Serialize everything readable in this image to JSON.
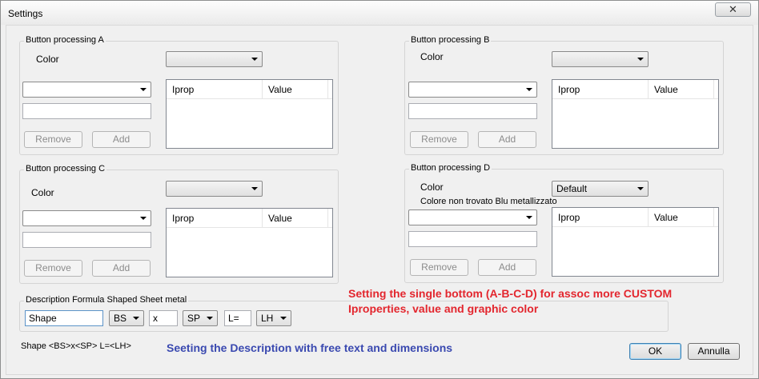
{
  "window": {
    "title": "Settings",
    "close_glyph": "✕"
  },
  "groups": {
    "a": {
      "label": "Button processing A",
      "color_label": "Color",
      "color_value": "",
      "combo_value": "",
      "text_value": "",
      "remove": "Remove",
      "add": "Add",
      "col1": "Iprop",
      "col2": "Value"
    },
    "b": {
      "label": "Button processing B",
      "color_label": "Color",
      "color_value": "",
      "combo_value": "",
      "text_value": "",
      "remove": "Remove",
      "add": "Add",
      "col1": "Iprop",
      "col2": "Value"
    },
    "c": {
      "label": "Button processing C",
      "color_label": "Color",
      "color_value": "",
      "combo_value": "",
      "text_value": "",
      "remove": "Remove",
      "add": "Add",
      "col1": "Iprop",
      "col2": "Value"
    },
    "d": {
      "label": "Button processing D",
      "color_label": "Color",
      "color_value": "Default",
      "note": "Colore non trovato Blu metallizzato",
      "combo_value": "",
      "text_value": "",
      "remove": "Remove",
      "add": "Add",
      "col1": "Iprop",
      "col2": "Value"
    }
  },
  "formula": {
    "label": "Description Formula Shaped Sheet metal",
    "shape_value": "Shape",
    "bs_value": "BS",
    "x_value": "x",
    "sp_value": "SP",
    "l_value": "L=",
    "lh_value": "LH"
  },
  "preview": "Shape <BS>x<SP> L=<LH>",
  "annotations": {
    "red_line1": "Setting the single  bottom  (A-B-C-D) for assoc more CUSTOM",
    "red_line2": "Iproperties, value and graphic color",
    "blue": "Seeting the Description with free text and dimensions"
  },
  "buttons": {
    "ok": "OK",
    "cancel": "Annulla"
  },
  "colors": {
    "red_annotation": "#e3262e",
    "blue_annotation": "#3a49b0",
    "window_bg": "#f0f0f0"
  }
}
